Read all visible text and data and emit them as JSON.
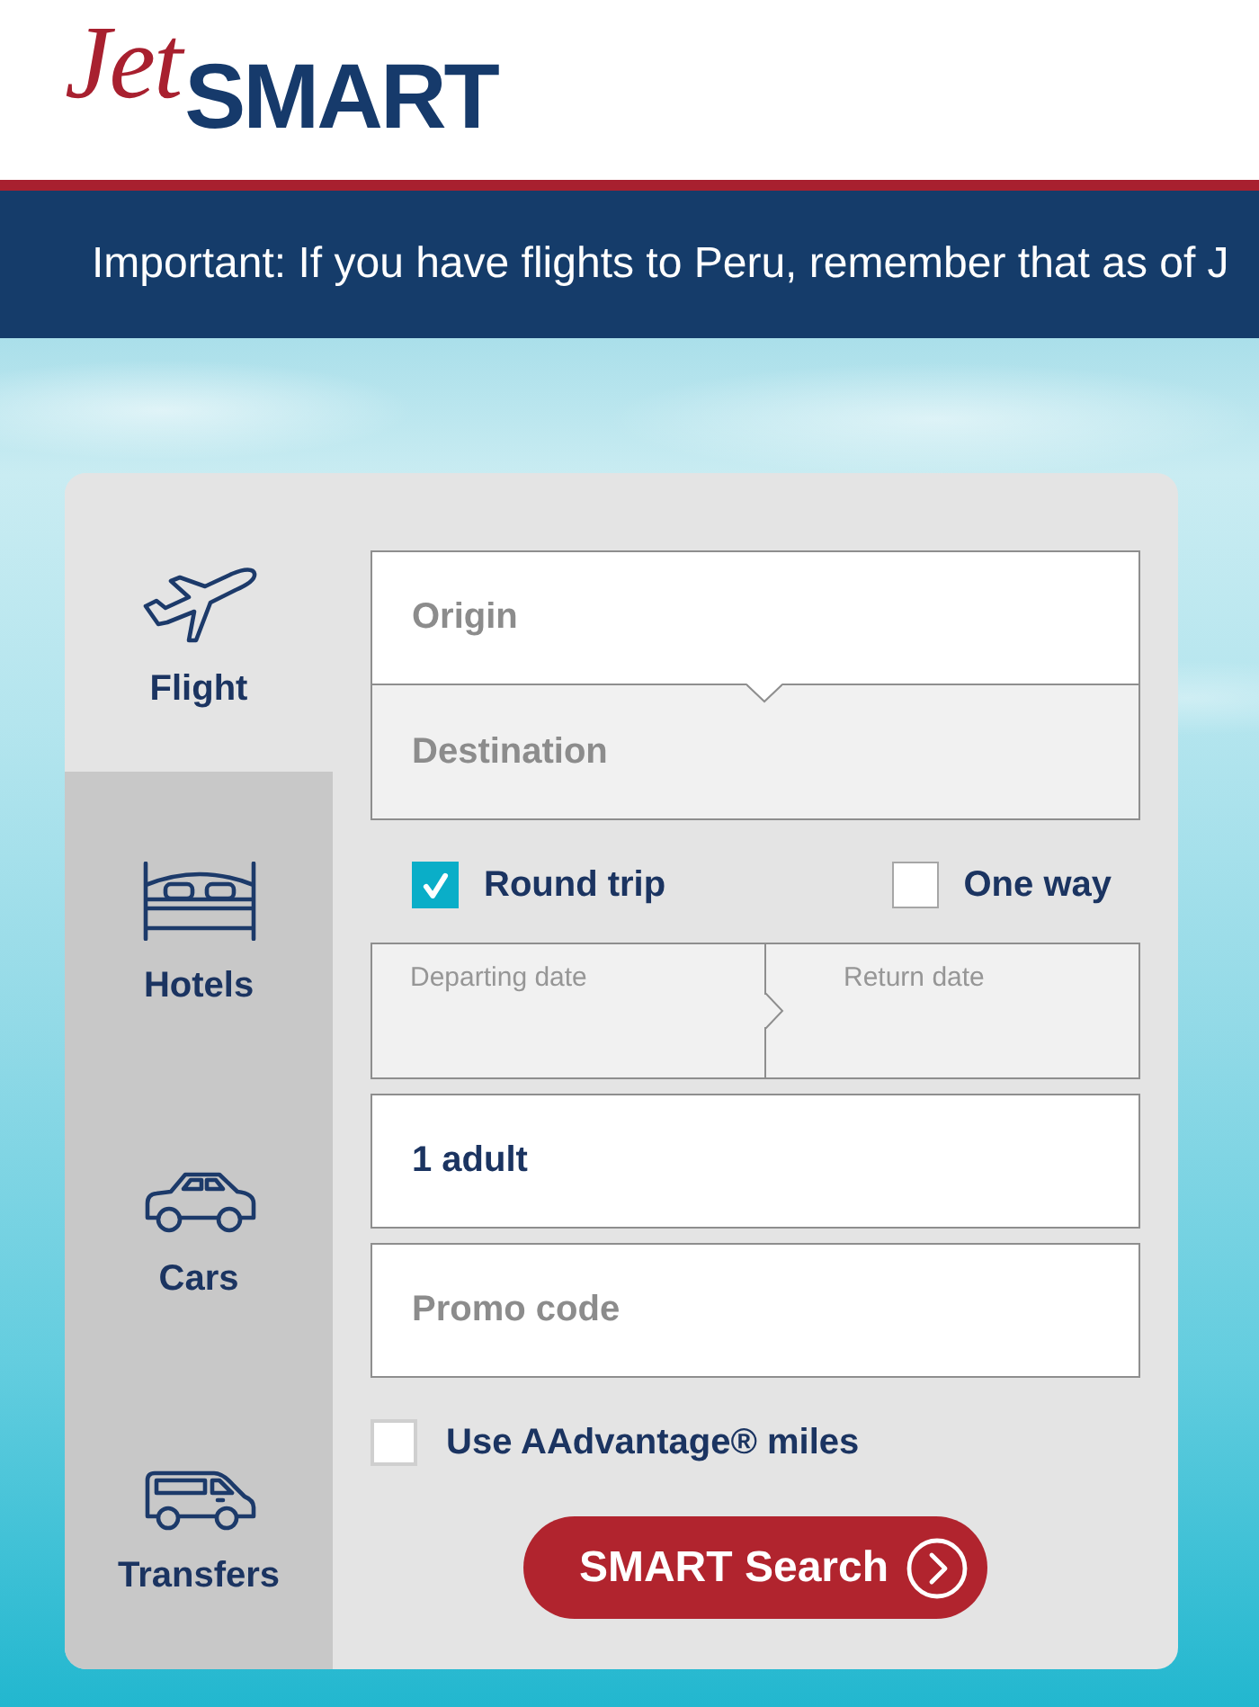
{
  "header": {
    "logo": {
      "script": "Jet",
      "wordmark": "SMART"
    }
  },
  "notice_banner": {
    "text": "Important: If you have flights to Peru, remember that as of J"
  },
  "booking_panel": {
    "tabs": [
      {
        "label": "Flight",
        "selected": true
      },
      {
        "label": "Hotels",
        "selected": false
      },
      {
        "label": "Cars",
        "selected": false
      },
      {
        "label": "Transfers",
        "selected": false
      }
    ],
    "route_fields": [
      {
        "placeholder": "Origin",
        "disabled": false
      },
      {
        "placeholder": "Destination",
        "disabled": true
      }
    ],
    "trip_types": [
      {
        "label": "Round trip",
        "selected": true
      },
      {
        "label": "One way",
        "selected": false
      }
    ],
    "date_fields": [
      {
        "label": "Departing date",
        "disabled": true
      },
      {
        "label": "Return date",
        "disabled": true
      }
    ],
    "passengers": {
      "value": "1 adult"
    },
    "promo_code": {
      "placeholder": "Promo code"
    },
    "miles_option": {
      "label": "Use AAdvantage® miles",
      "checked": false
    },
    "search_button": {
      "label": "SMART Search"
    }
  }
}
